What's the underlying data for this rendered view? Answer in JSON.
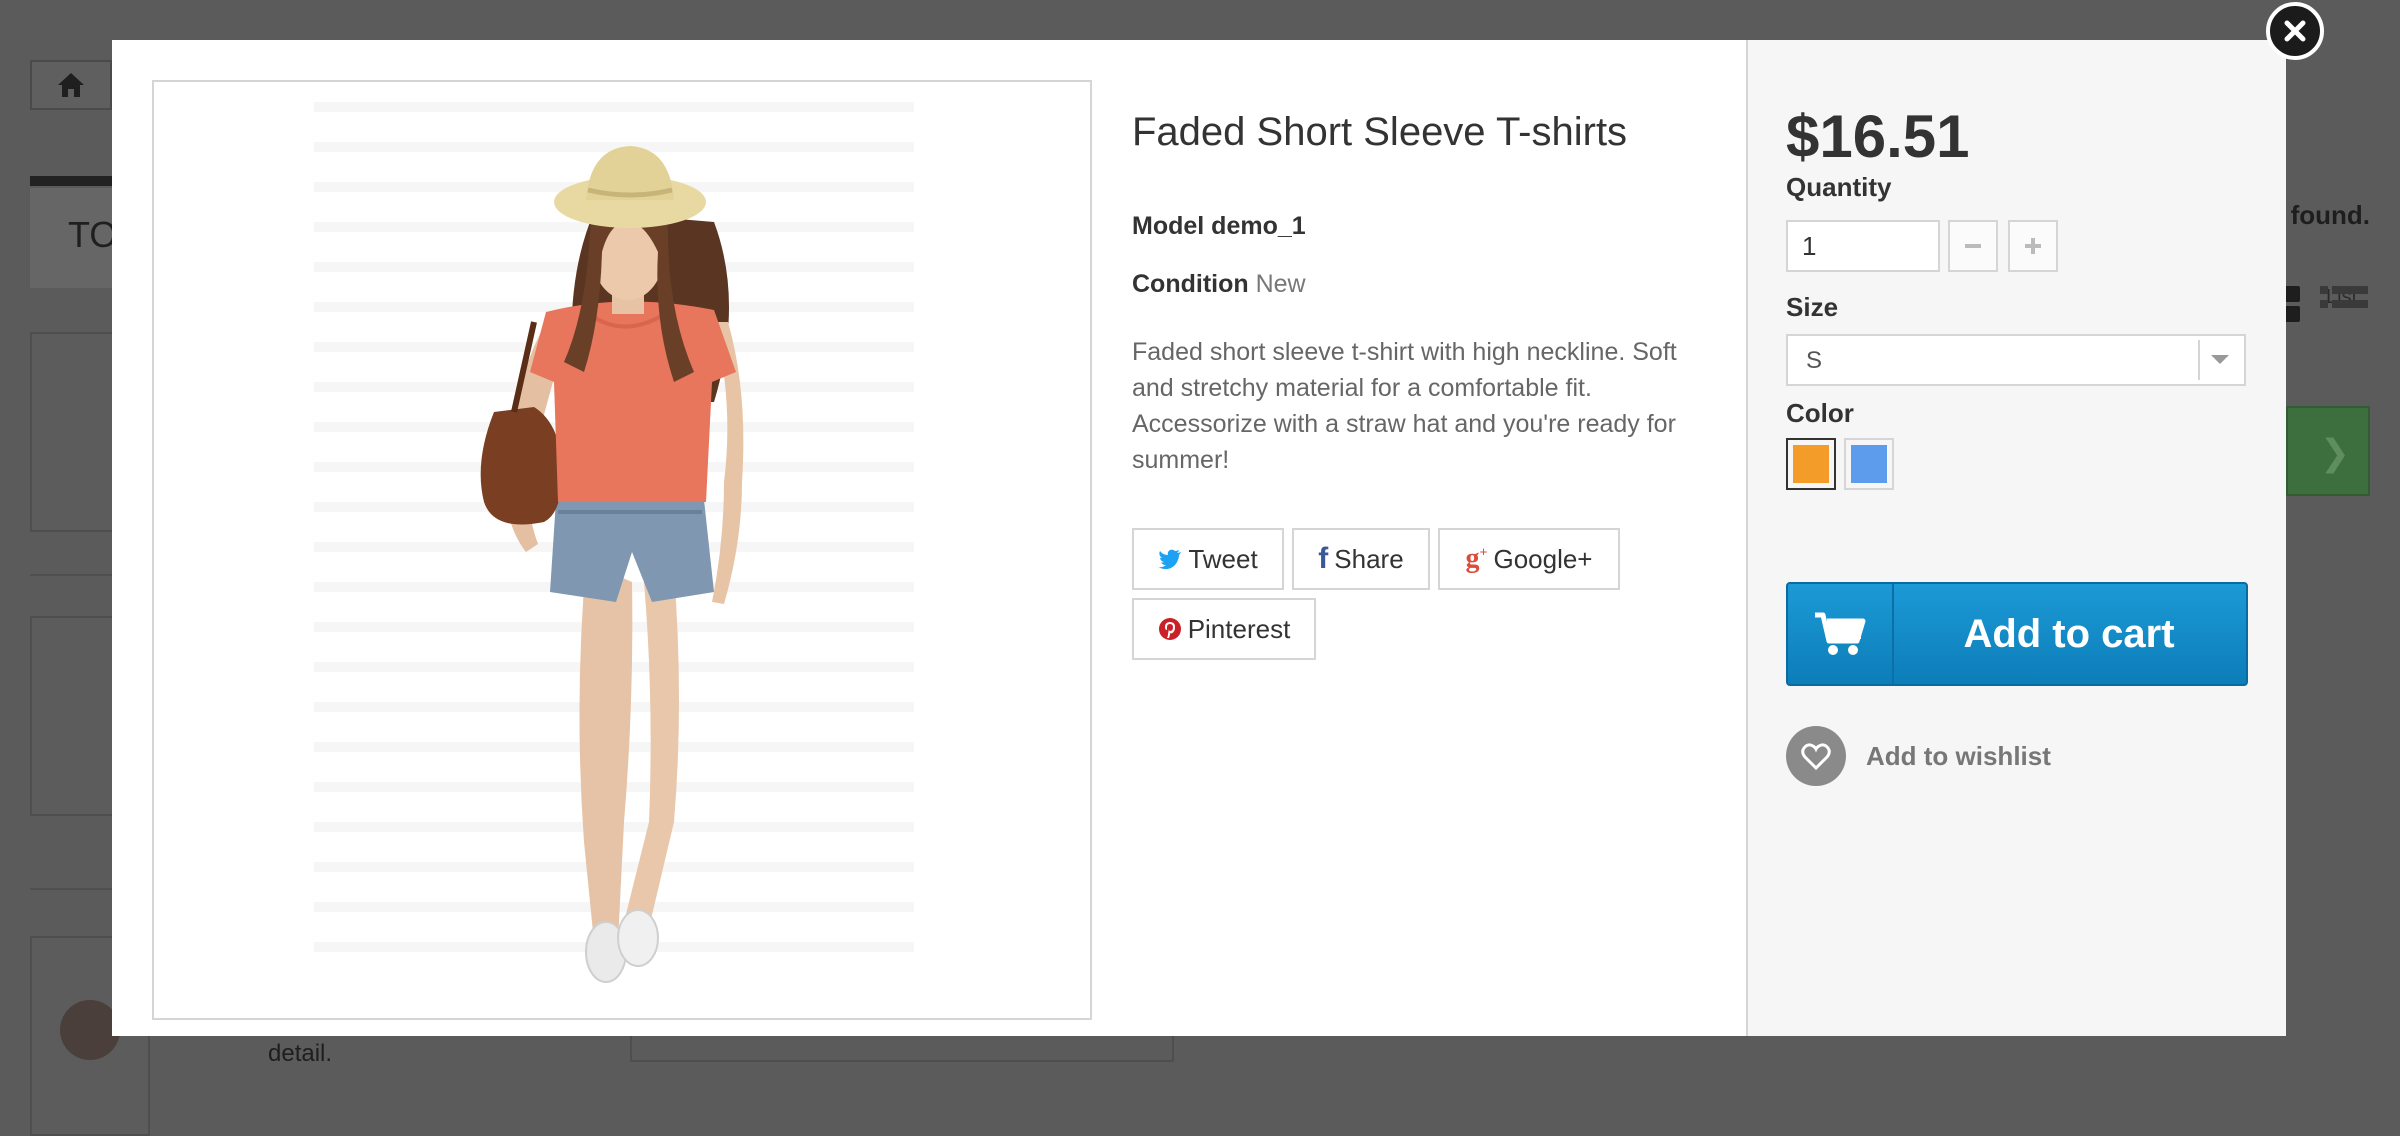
{
  "background": {
    "partial_heading": "TO",
    "results_text": "found.",
    "view_grid_label": "d",
    "view_list_label": "List",
    "detail_text": "detail."
  },
  "product": {
    "title": "Faded Short Sleeve T-shirts",
    "model_label": "Model",
    "model_value": "demo_1",
    "condition_label": "Condition",
    "condition_value": "New",
    "description": "Faded short sleeve t-shirt with high neckline. Soft and stretchy material for a comfortable fit. Accessorize with a straw hat and you're ready for summer!",
    "image_alt": "Woman in straw hat, coral t-shirt and denim shorts"
  },
  "share": {
    "tweet": "Tweet",
    "share": "Share",
    "googleplus": "Google+",
    "pinterest": "Pinterest"
  },
  "purchase": {
    "price": "$16.51",
    "quantity_label": "Quantity",
    "quantity_value": "1",
    "size_label": "Size",
    "size_value": "S",
    "color_label": "Color",
    "colors": [
      "#f39c2a",
      "#5d9cec"
    ],
    "add_to_cart": "Add to cart",
    "add_to_wishlist": "Add to wishlist"
  },
  "colors": {
    "accent_blue": "#1a94d2",
    "twitter": "#1da1f2",
    "facebook": "#3b5998",
    "googleplus": "#dd4b39",
    "pinterest": "#cb2027"
  }
}
